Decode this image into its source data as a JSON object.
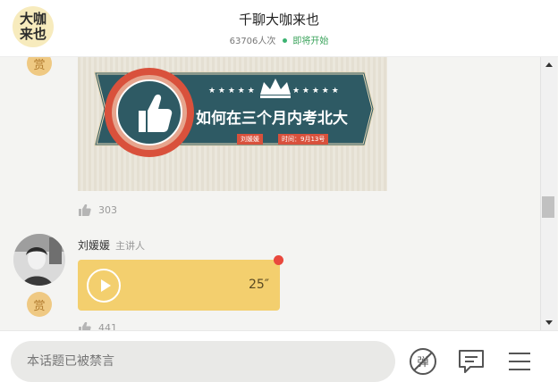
{
  "header": {
    "logo_text": "大咖来也",
    "title": "千聊大咖来也",
    "views": "63706人次",
    "status": "即将开始"
  },
  "feed": {
    "reward_label": "赏",
    "banner": {
      "headline": "如何在三个月内考北大",
      "speaker_tag": "刘媛媛",
      "date_tag": "时间：9月13号"
    },
    "banner_likes": "303",
    "message": {
      "speaker": "刘媛媛",
      "role": "主讲人",
      "duration": "25″",
      "likes": "441"
    }
  },
  "footer": {
    "input_placeholder": "本话题已被禁言"
  },
  "colors": {
    "audio_bg": "#f3cf6e",
    "reward_bg": "#efc983",
    "status_green": "#3aa35b",
    "unread_red": "#e9483d",
    "banner_teal": "#2e5a64",
    "banner_red": "#d9513c"
  },
  "icons": [
    "thumbs-up-icon",
    "play-icon",
    "danmaku-off-icon",
    "comment-icon",
    "menu-icon"
  ]
}
